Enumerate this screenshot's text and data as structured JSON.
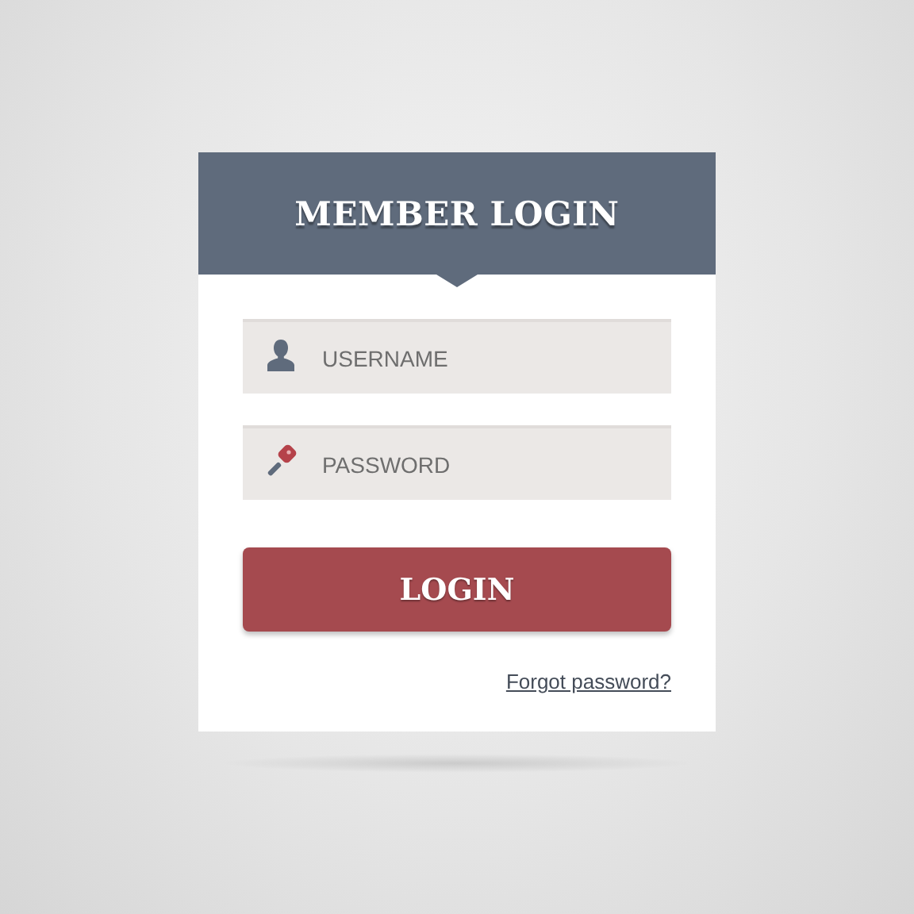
{
  "title": "MEMBER LOGIN",
  "fields": [
    {
      "kind": "username",
      "placeholder": "USERNAME"
    },
    {
      "kind": "password",
      "placeholder": "PASSWORD"
    }
  ],
  "button": "LOGIN",
  "link": "Forgot password?"
}
